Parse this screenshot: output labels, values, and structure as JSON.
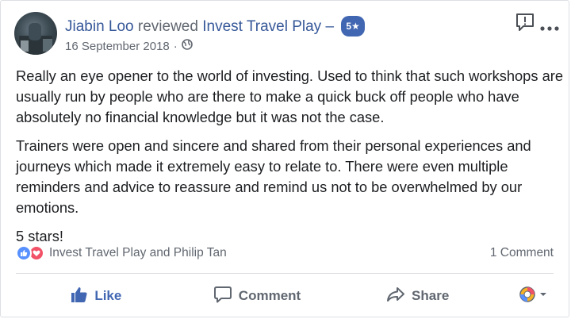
{
  "post": {
    "author": "Jiabin Loo",
    "action": "reviewed",
    "page_name": "Invest Travel Play",
    "dash": "–",
    "rating": "5★",
    "date": "16 September 2018",
    "separator": "·"
  },
  "content": {
    "paragraphs": [
      "Really an eye opener to the world of investing. Used to think that such workshops are usually run by people who are there to make a quick buck off people who have absolutely no financial knowledge but it was not the case.",
      "Trainers were open and sincere and shared from their personal experiences and journeys which made it extremely easy to relate to. There were even multiple reminders and advice to reassure and remind us not to be overwhelmed by our emotions.",
      "5 stars!"
    ]
  },
  "reactions": {
    "names": "Invest Travel Play and Philip Tan",
    "comments": "1 Comment"
  },
  "actions": {
    "like": "Like",
    "comment": "Comment",
    "share": "Share"
  },
  "icons": [
    "flag-icon",
    "more-options-icon",
    "globe-icon",
    "like-reaction-icon",
    "love-reaction-icon",
    "thumbs-up-icon",
    "comment-icon",
    "share-icon",
    "reaction-picker-icon"
  ],
  "colors": {
    "link": "#365899",
    "brand": "#4267b2",
    "like": "#5890ff",
    "love": "#f25268"
  }
}
